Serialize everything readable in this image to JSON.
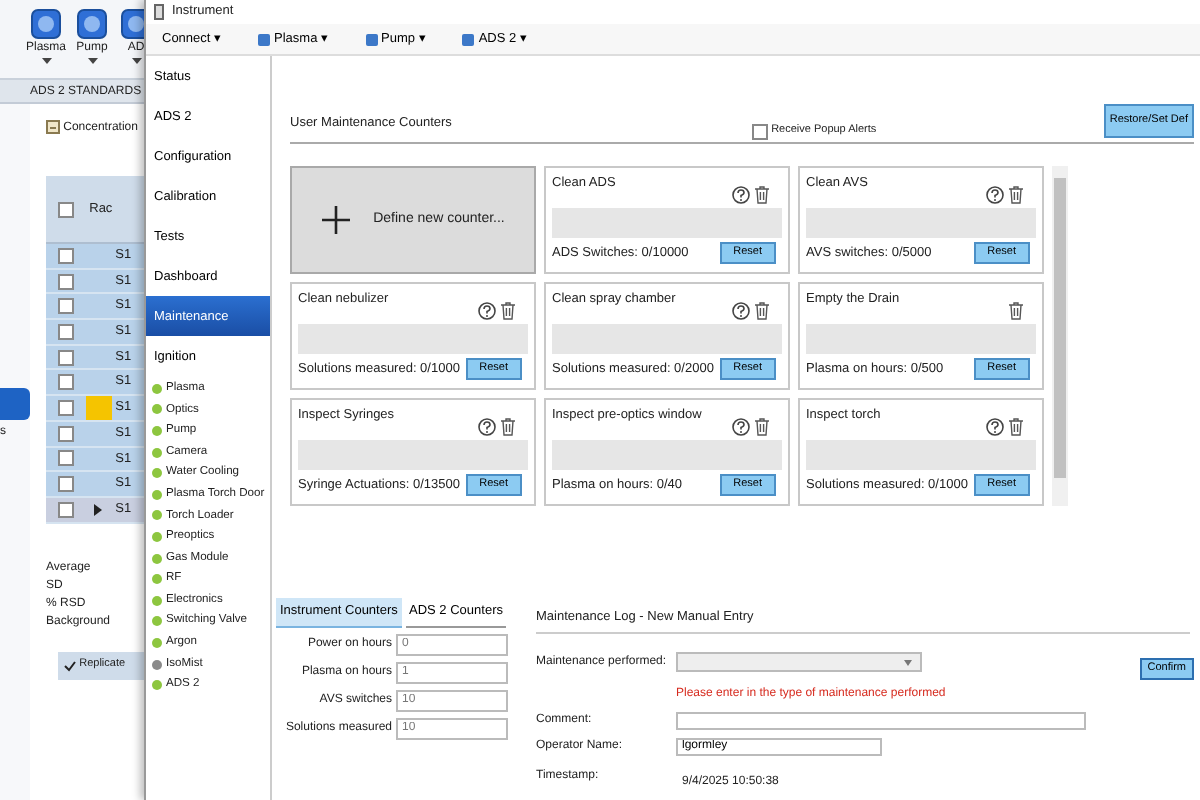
{
  "background_app": {
    "toolbar": [
      {
        "label": "Plasma"
      },
      {
        "label": "Pump"
      },
      {
        "label": "AD"
      }
    ],
    "tab": "ADS 2 STANDARDS",
    "side_items": [
      {
        "selected": true
      },
      {
        "label": "s",
        "selected": false
      }
    ],
    "toolbar_label": "Concentration",
    "table": {
      "columns": [
        "Rac"
      ],
      "header_checked": false,
      "rows": [
        {
          "cell": "S1",
          "checked": false,
          "flagged": false,
          "current": false
        },
        {
          "cell": "S1",
          "checked": false,
          "flagged": false,
          "current": false
        },
        {
          "cell": "S1",
          "checked": false,
          "flagged": false,
          "current": false
        },
        {
          "cell": "S1",
          "checked": false,
          "flagged": false,
          "current": false
        },
        {
          "cell": "S1",
          "checked": false,
          "flagged": false,
          "current": false
        },
        {
          "cell": "S1",
          "checked": false,
          "flagged": false,
          "current": false
        },
        {
          "cell": "S1",
          "checked": false,
          "flagged": true,
          "current": false
        },
        {
          "cell": "S1",
          "checked": false,
          "flagged": false,
          "current": false
        },
        {
          "cell": "S1",
          "checked": false,
          "flagged": false,
          "current": false
        },
        {
          "cell": "S1",
          "checked": false,
          "flagged": false,
          "current": false
        },
        {
          "cell": "S1",
          "checked": false,
          "flagged": false,
          "current": true
        }
      ]
    },
    "stats": [
      "Average",
      "SD",
      "% RSD",
      "Background"
    ],
    "replicate": {
      "label": "Replicate",
      "checked": true
    }
  },
  "window": {
    "title": "Instrument"
  },
  "menu": [
    {
      "label": "Connect ▾",
      "kind": "plain"
    },
    {
      "label": "Plasma ▾",
      "kind": "icon"
    },
    {
      "label": "Pump ▾",
      "kind": "icon"
    },
    {
      "label": "ADS 2 ▾",
      "kind": "icon"
    }
  ],
  "nav": [
    {
      "label": "Status",
      "selected": false
    },
    {
      "label": "ADS 2",
      "selected": false
    },
    {
      "label": "Configuration",
      "selected": false
    },
    {
      "label": "Calibration",
      "selected": false
    },
    {
      "label": "Tests",
      "selected": false
    },
    {
      "label": "Dashboard",
      "selected": false
    },
    {
      "label": "Maintenance",
      "selected": true
    },
    {
      "label": "Ignition",
      "selected": false
    }
  ],
  "status_list": [
    {
      "label": "Plasma",
      "color": "#8dc63f"
    },
    {
      "label": "Optics",
      "color": "#8dc63f"
    },
    {
      "label": "Pump",
      "color": "#8dc63f"
    },
    {
      "label": "Camera",
      "color": "#8dc63f"
    },
    {
      "label": "Water Cooling",
      "color": "#8dc63f"
    },
    {
      "label": "Plasma Torch Door",
      "color": "#8dc63f"
    },
    {
      "label": "Torch Loader",
      "color": "#8dc63f"
    },
    {
      "label": "Preoptics",
      "color": "#8dc63f"
    },
    {
      "label": "Gas Module",
      "color": "#8dc63f"
    },
    {
      "label": "RF",
      "color": "#8dc63f"
    },
    {
      "label": "Electronics",
      "color": "#8dc63f"
    },
    {
      "label": "Switching Valve",
      "color": "#8dc63f"
    },
    {
      "label": "Argon",
      "color": "#8dc63f"
    },
    {
      "label": "IsoMist",
      "color": "#8a8a8a"
    },
    {
      "label": "ADS 2",
      "color": "#8dc63f"
    }
  ],
  "counters": {
    "title": "User Maintenance Counters",
    "popup_alerts": {
      "label": "Receive Popup Alerts",
      "checked": false
    },
    "restore_button": "Restore/Set Def",
    "new_counter": "Define new counter...",
    "items": [
      {
        "title": "Clean ADS",
        "help": true,
        "reading": "ADS Switches: 0/10000",
        "level": 0,
        "button": "Reset"
      },
      {
        "title": "Clean AVS",
        "help": true,
        "reading": "AVS switches: 0/5000",
        "level": 0,
        "button": "Reset"
      },
      {
        "title": "Clean nebulizer",
        "help": true,
        "reading": "Solutions measured: 0/1000",
        "level": 0,
        "button": "Reset"
      },
      {
        "title": "Clean spray chamber",
        "help": true,
        "reading": "Solutions measured: 0/2000",
        "level": 0,
        "button": "Reset"
      },
      {
        "title": "Empty the Drain",
        "help": false,
        "reading": "Plasma on hours: 0/500",
        "level": 0,
        "button": "Reset"
      },
      {
        "title": "Inspect Syringes",
        "help": true,
        "reading": "Syringe Actuations: 0/13500",
        "level": 0,
        "button": "Reset"
      },
      {
        "title": "Inspect pre-optics window",
        "help": true,
        "reading": "Plasma on hours: 0/40",
        "level": 0,
        "button": "Reset"
      },
      {
        "title": "Inspect torch",
        "help": true,
        "reading": "Solutions measured: 0/1000",
        "level": 0,
        "button": "Reset"
      }
    ]
  },
  "instrument_counters": {
    "tabs": [
      {
        "label": "Instrument Counters",
        "selected": true
      },
      {
        "label": "ADS 2 Counters",
        "selected": false
      }
    ],
    "fields": [
      {
        "label": "Power on hours",
        "value": "0"
      },
      {
        "label": "Plasma on hours",
        "value": "1"
      },
      {
        "label": "AVS switches",
        "value": "10"
      },
      {
        "label": "Solutions measured",
        "value": "10"
      }
    ]
  },
  "maintenance_log": {
    "title": "Maintenance Log - New Manual Entry",
    "performed_label": "Maintenance performed:",
    "error": "Please enter in the type of maintenance performed",
    "comment_label": "Comment:",
    "operator_label": "Operator Name:",
    "operator_value": "lgormley",
    "timestamp_label": "Timestamp:",
    "timestamp_value": "9/4/2025 10:50:38",
    "confirm_button": "Confirm"
  }
}
